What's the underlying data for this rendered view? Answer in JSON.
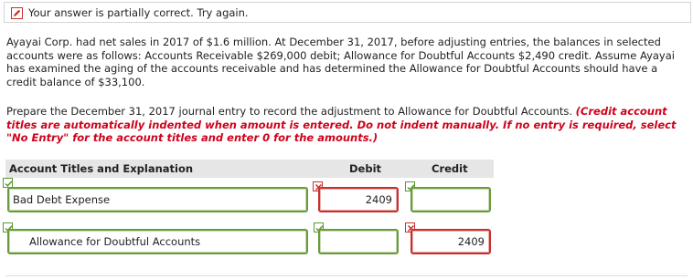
{
  "status": {
    "message": "Your answer is partially correct.  Try again."
  },
  "question": {
    "paragraph1": "Ayayai Corp. had net sales in 2017 of $1.6 million. At December 31, 2017, before adjusting entries, the balances in selected accounts were as follows: Accounts Receivable $269,000 debit; Allowance for Doubtful Accounts $2,490 credit. Assume Ayayai has examined the aging of the accounts receivable and has determined the Allowance for Doubtful Accounts should have a credit balance of $33,100.",
    "paragraph2_plain": "Prepare the December 31, 2017 journal entry to record the adjustment to Allowance for Doubtful Accounts. ",
    "paragraph2_instruction": "(Credit account titles are automatically indented when amount is entered. Do not indent manually. If no entry is required, select \"No Entry\" for the account titles and enter 0 for the amounts.)"
  },
  "table": {
    "headers": {
      "account": "Account Titles and Explanation",
      "debit": "Debit",
      "credit": "Credit"
    },
    "rows": [
      {
        "account": "Bad Debt Expense",
        "debit": "2409",
        "credit": ""
      },
      {
        "account": "Allowance for Doubtful Accounts",
        "debit": "",
        "credit": "2409"
      }
    ]
  },
  "colors": {
    "correct": "#6a9a3c",
    "incorrect": "#c9302c",
    "instruction": "#d0021b",
    "header_bg": "#e6e6e6"
  },
  "icons": {
    "status": "pencil-icon",
    "correct": "check-icon",
    "incorrect": "x-icon"
  }
}
